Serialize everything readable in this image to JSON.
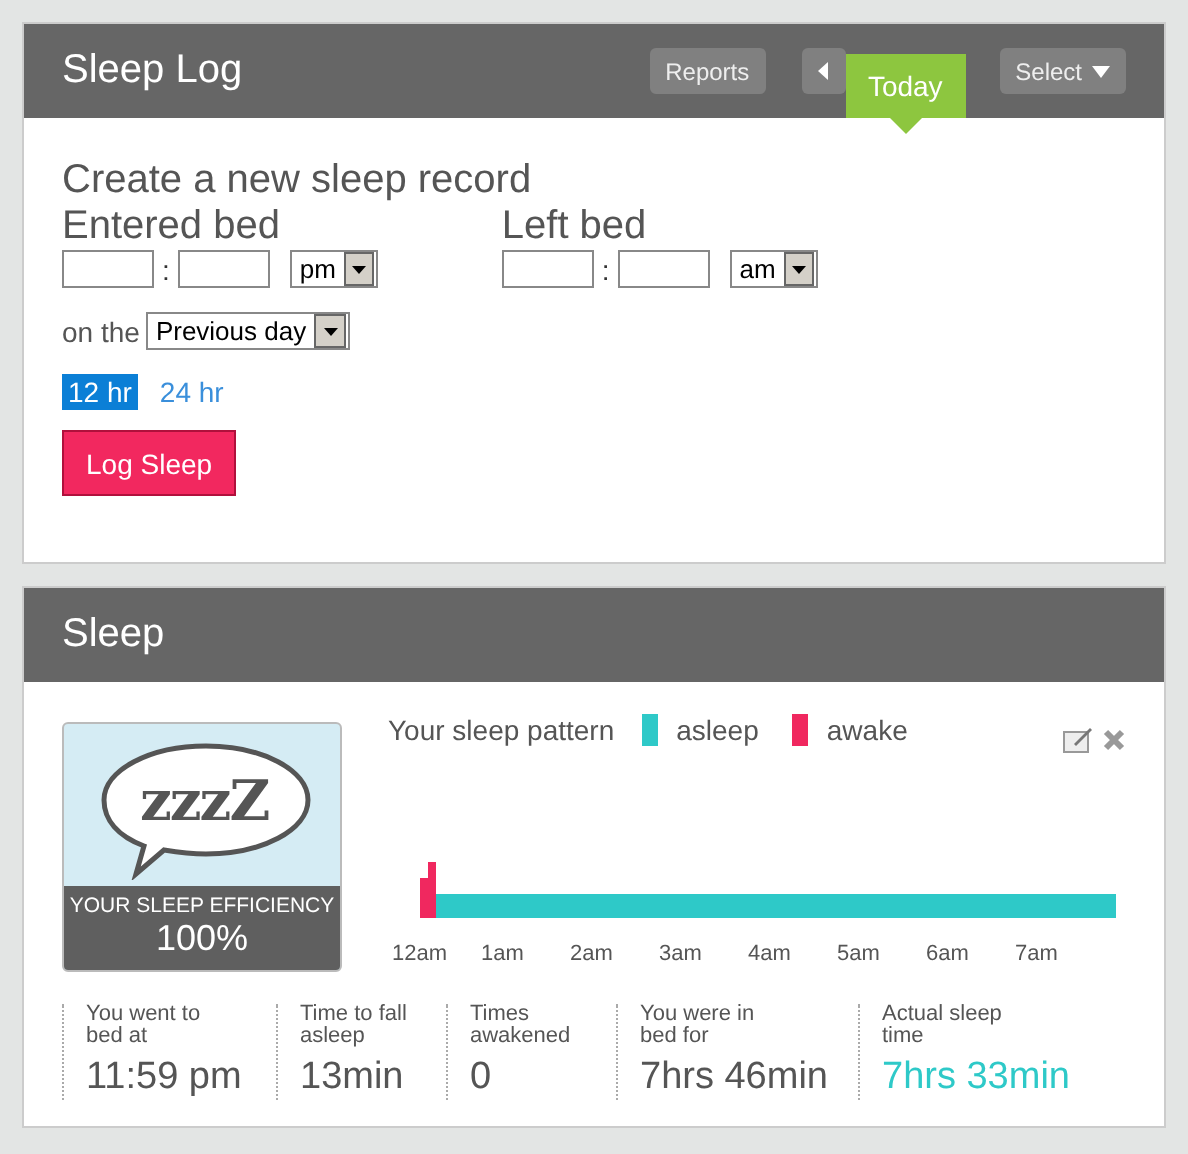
{
  "sleep_log": {
    "title": "Sleep Log",
    "toolbar": [
      {
        "kind": "button",
        "label": "Reports",
        "selected": false
      },
      {
        "kind": "prev",
        "selected": false
      },
      {
        "kind": "tab",
        "label": "Today",
        "selected": true
      },
      {
        "kind": "dropdown",
        "label": "Select",
        "selected": false
      }
    ],
    "form": {
      "heading": "Create a new sleep record",
      "entered": {
        "label": "Entered bed",
        "separator": ":",
        "period": "pm"
      },
      "left": {
        "label": "Left bed",
        "separator": ":",
        "period": "am"
      },
      "day_label": "on the",
      "day": "Previous day",
      "formats": [
        {
          "label": "12 hr",
          "selected": true
        },
        {
          "label": "24 hr",
          "selected": false
        }
      ],
      "submit": "Log Sleep"
    }
  },
  "sleep": {
    "title": "Sleep",
    "efficiency": {
      "bubble": "zzzZ",
      "label": "YOUR SLEEP EFFICIENCY",
      "value": "100%"
    },
    "pattern": {
      "title": "Your sleep pattern",
      "legend": [
        {
          "label": "asleep",
          "color": "#2ec9c8"
        },
        {
          "label": "awake",
          "color": "#f0285f"
        }
      ],
      "time_labels": [
        "12am",
        "1am",
        "2am",
        "3am",
        "4am",
        "5am",
        "6am",
        "7am"
      ]
    },
    "stats": [
      {
        "label": "You went to bed at",
        "value": "11:59 pm",
        "highlighted": false
      },
      {
        "label": "Time to fall asleep",
        "value": "13min",
        "highlighted": false
      },
      {
        "label": "Times awakened",
        "value": "0",
        "highlighted": false
      },
      {
        "label": "You were in bed for",
        "value": "7hrs 46min",
        "highlighted": false
      },
      {
        "label": "Actual sleep time",
        "value": "7hrs 33min",
        "highlighted": true
      }
    ]
  }
}
